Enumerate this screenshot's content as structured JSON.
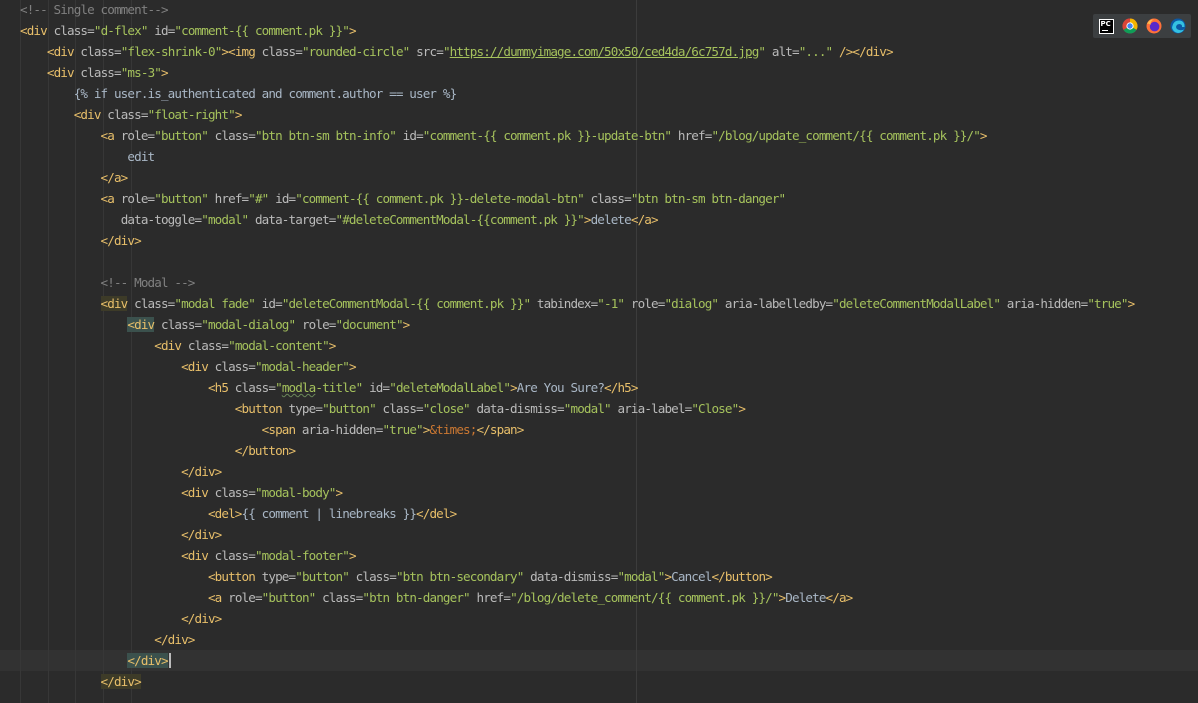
{
  "editor": {
    "language": "html-django-template",
    "caret_line": 31,
    "lines": [
      [
        [
          "cm",
          "<!-- Single comment-->"
        ]
      ],
      [
        [
          "t",
          "<div"
        ],
        [
          "an",
          " class="
        ],
        [
          "av",
          "\"d-flex\""
        ],
        [
          "an",
          " id="
        ],
        [
          "av",
          "\"comment-{{ comment.pk }}\""
        ],
        [
          "t",
          ">"
        ]
      ],
      [
        [
          "tx",
          "    "
        ],
        [
          "t",
          "<div"
        ],
        [
          "an",
          " class="
        ],
        [
          "av",
          "\"flex-shrink-0\""
        ],
        [
          "t",
          "><img"
        ],
        [
          "an",
          " class="
        ],
        [
          "av",
          "\"rounded-circle\""
        ],
        [
          "an",
          " src="
        ],
        [
          "av",
          "\""
        ],
        [
          "av lk",
          "https://dummyimage.com/50x50/ced4da/6c757d.jpg"
        ],
        [
          "av",
          "\""
        ],
        [
          "an",
          " alt="
        ],
        [
          "av",
          "\"...\""
        ],
        [
          "t",
          " /></div>"
        ]
      ],
      [
        [
          "tx",
          "    "
        ],
        [
          "t",
          "<div"
        ],
        [
          "an",
          " class="
        ],
        [
          "av",
          "\"ms-3\""
        ],
        [
          "t",
          ">"
        ]
      ],
      [
        [
          "tx",
          "        {% if user.is_authenticated and comment.author == user %}"
        ]
      ],
      [
        [
          "tx",
          "        "
        ],
        [
          "t",
          "<div"
        ],
        [
          "an",
          " class="
        ],
        [
          "av",
          "\"float-right\""
        ],
        [
          "t",
          ">"
        ]
      ],
      [
        [
          "tx",
          "            "
        ],
        [
          "t",
          "<a"
        ],
        [
          "an",
          " role="
        ],
        [
          "av",
          "\"button\""
        ],
        [
          "an",
          " class="
        ],
        [
          "av",
          "\"btn btn-sm btn-info\""
        ],
        [
          "an",
          " id="
        ],
        [
          "av",
          "\"comment-{{ comment.pk }}-update-btn\""
        ],
        [
          "an",
          " href="
        ],
        [
          "av",
          "\"/blog/update_comment/{{ comment.pk }}/\""
        ],
        [
          "t",
          ">"
        ]
      ],
      [
        [
          "tx",
          "                edit"
        ]
      ],
      [
        [
          "tx",
          "            "
        ],
        [
          "t",
          "</a>"
        ]
      ],
      [
        [
          "tx",
          "            "
        ],
        [
          "t",
          "<a"
        ],
        [
          "an",
          " role="
        ],
        [
          "av",
          "\"button\""
        ],
        [
          "an",
          " href="
        ],
        [
          "av",
          "\"#\""
        ],
        [
          "an",
          " id="
        ],
        [
          "av",
          "\"comment-{{ comment.pk }}-delete-modal-btn\""
        ],
        [
          "an",
          " class="
        ],
        [
          "av",
          "\"btn btn-sm btn-danger\""
        ]
      ],
      [
        [
          "tx",
          "               "
        ],
        [
          "an",
          "data-toggle="
        ],
        [
          "av",
          "\"modal\""
        ],
        [
          "an",
          " data-target="
        ],
        [
          "av",
          "\"#deleteCommentModal-{{comment.pk }}\""
        ],
        [
          "t",
          ">"
        ],
        [
          "tx",
          "delete"
        ],
        [
          "t",
          "</a>"
        ]
      ],
      [
        [
          "tx",
          "            "
        ],
        [
          "t",
          "</div>"
        ]
      ],
      [
        [
          "tx",
          ""
        ]
      ],
      [
        [
          "tx",
          "            "
        ],
        [
          "cm",
          "<!-- Modal -->"
        ]
      ],
      [
        [
          "tx",
          "            "
        ],
        [
          "t hy",
          "<div"
        ],
        [
          "an",
          " class="
        ],
        [
          "av",
          "\"modal fade\""
        ],
        [
          "an",
          " id="
        ],
        [
          "av",
          "\"deleteCommentModal-{{ comment.pk }}\""
        ],
        [
          "an",
          " tabindex="
        ],
        [
          "av",
          "\"-1\""
        ],
        [
          "an",
          " role="
        ],
        [
          "av",
          "\"dialog\""
        ],
        [
          "an",
          " aria-labelledby="
        ],
        [
          "av",
          "\"deleteCommentModalLabel\""
        ],
        [
          "an",
          " aria-hidden="
        ],
        [
          "av",
          "\"true\""
        ],
        [
          "t",
          ">"
        ]
      ],
      [
        [
          "tx",
          "                "
        ],
        [
          "t hl",
          "<div"
        ],
        [
          "an",
          " class="
        ],
        [
          "av",
          "\"modal-dialog\""
        ],
        [
          "an",
          " role="
        ],
        [
          "av",
          "\"document\""
        ],
        [
          "t",
          ">"
        ]
      ],
      [
        [
          "tx",
          "                    "
        ],
        [
          "t",
          "<div"
        ],
        [
          "an",
          " class="
        ],
        [
          "av",
          "\"modal-content\""
        ],
        [
          "t",
          ">"
        ]
      ],
      [
        [
          "tx",
          "                        "
        ],
        [
          "t",
          "<div"
        ],
        [
          "an",
          " class="
        ],
        [
          "av",
          "\"modal-header\""
        ],
        [
          "t",
          ">"
        ]
      ],
      [
        [
          "tx",
          "                            "
        ],
        [
          "t",
          "<h5"
        ],
        [
          "an",
          " class="
        ],
        [
          "av",
          "\""
        ],
        [
          "av wv",
          "modla"
        ],
        [
          "av",
          "-title\""
        ],
        [
          "an",
          " id="
        ],
        [
          "av",
          "\"deleteModalLabel\""
        ],
        [
          "t",
          ">"
        ],
        [
          "tx",
          "Are You Sure?"
        ],
        [
          "t",
          "</h5>"
        ]
      ],
      [
        [
          "tx",
          "                                "
        ],
        [
          "t",
          "<button"
        ],
        [
          "an",
          " type="
        ],
        [
          "av",
          "\"button\""
        ],
        [
          "an",
          " class="
        ],
        [
          "av",
          "\"close\""
        ],
        [
          "an",
          " data-dismiss="
        ],
        [
          "av",
          "\"modal\""
        ],
        [
          "an",
          " aria-label="
        ],
        [
          "av",
          "\"Close\""
        ],
        [
          "t",
          ">"
        ]
      ],
      [
        [
          "tx",
          "                                    "
        ],
        [
          "t",
          "<span"
        ],
        [
          "an",
          " aria-hidden="
        ],
        [
          "av",
          "\"true\""
        ],
        [
          "t",
          ">"
        ],
        [
          "en",
          "&times;"
        ],
        [
          "t",
          "</span>"
        ]
      ],
      [
        [
          "tx",
          "                                "
        ],
        [
          "t",
          "</button>"
        ]
      ],
      [
        [
          "tx",
          "                        "
        ],
        [
          "t",
          "</div>"
        ]
      ],
      [
        [
          "tx",
          "                        "
        ],
        [
          "t",
          "<div"
        ],
        [
          "an",
          " class="
        ],
        [
          "av",
          "\"modal-body\""
        ],
        [
          "t",
          ">"
        ]
      ],
      [
        [
          "tx",
          "                            "
        ],
        [
          "t",
          "<del>"
        ],
        [
          "tx",
          "{{ comment | linebreaks }}"
        ],
        [
          "t",
          "</del>"
        ]
      ],
      [
        [
          "tx",
          "                        "
        ],
        [
          "t",
          "</div>"
        ]
      ],
      [
        [
          "tx",
          "                        "
        ],
        [
          "t",
          "<div"
        ],
        [
          "an",
          " class="
        ],
        [
          "av",
          "\"modal-footer\""
        ],
        [
          "t",
          ">"
        ]
      ],
      [
        [
          "tx",
          "                            "
        ],
        [
          "t",
          "<button"
        ],
        [
          "an",
          " type="
        ],
        [
          "av",
          "\"button\""
        ],
        [
          "an",
          " class="
        ],
        [
          "av",
          "\"btn btn-secondary\""
        ],
        [
          "an",
          " data-dismiss="
        ],
        [
          "av",
          "\"modal\""
        ],
        [
          "t",
          ">"
        ],
        [
          "tx",
          "Cancel"
        ],
        [
          "t",
          "</button>"
        ]
      ],
      [
        [
          "tx",
          "                            "
        ],
        [
          "t",
          "<a"
        ],
        [
          "an",
          " role="
        ],
        [
          "av",
          "\"button\""
        ],
        [
          "an",
          " class="
        ],
        [
          "av",
          "\"btn btn-danger\""
        ],
        [
          "an",
          " href="
        ],
        [
          "av",
          "\"/blog/delete_comment/{{ comment.pk }}/\""
        ],
        [
          "t",
          ">"
        ],
        [
          "tx",
          "Delete"
        ],
        [
          "t",
          "</a>"
        ]
      ],
      [
        [
          "tx",
          "                        "
        ],
        [
          "t",
          "</div>"
        ]
      ],
      [
        [
          "tx",
          "                    "
        ],
        [
          "t",
          "</div>"
        ]
      ],
      [
        [
          "tx",
          "                "
        ],
        [
          "t hl",
          "</div>"
        ]
      ],
      [
        [
          "tx",
          "            "
        ],
        [
          "t hy",
          "</div>"
        ]
      ]
    ]
  },
  "browser_icons": [
    {
      "name": "pycharm-icon",
      "label": "PC"
    },
    {
      "name": "chrome-icon",
      "label": ""
    },
    {
      "name": "firefox-icon",
      "label": ""
    },
    {
      "name": "edge-icon",
      "label": ""
    }
  ]
}
